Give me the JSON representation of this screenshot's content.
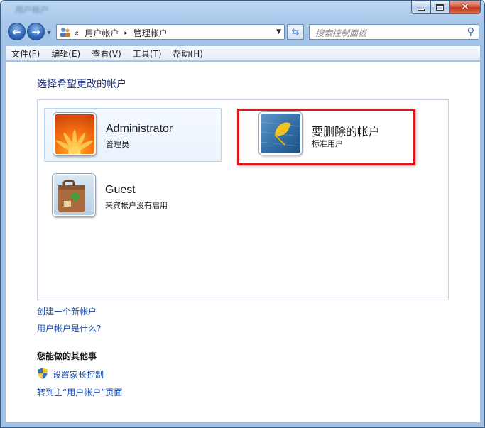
{
  "window": {
    "title": "用户帐户",
    "buttons": {
      "minimize": "minimize",
      "maximize": "maximize",
      "close": "✕"
    }
  },
  "address_bar": {
    "overflow": "«",
    "crumbs": [
      "用户帐户",
      "管理帐户"
    ],
    "separator": "▸"
  },
  "search": {
    "placeholder": "搜索控制面板"
  },
  "menu": [
    "文件(F)",
    "编辑(E)",
    "查看(V)",
    "工具(T)",
    "帮助(H)"
  ],
  "main": {
    "heading": "选择希望更改的帐户",
    "accounts": [
      {
        "name": "Administrator",
        "type": "管理员",
        "picture": "flower-icon"
      },
      {
        "name": "要删除的帐户",
        "type": "标准用户",
        "picture": "leaf-icon"
      },
      {
        "name": "Guest",
        "type": "来宾帐户没有启用",
        "picture": "suitcase-icon"
      }
    ],
    "links": {
      "create_account": "创建一个新帐户",
      "what_is_account": "用户帐户是什么?"
    },
    "other_section": {
      "title": "您能做的其他事",
      "parental_control": "设置家长控制",
      "goto_main": "转到主“用户帐户”页面"
    }
  },
  "colors": {
    "link": "#1e4fae",
    "heading": "#1e3287",
    "highlight": "#e0141a",
    "frame": "#a8c8ea"
  }
}
